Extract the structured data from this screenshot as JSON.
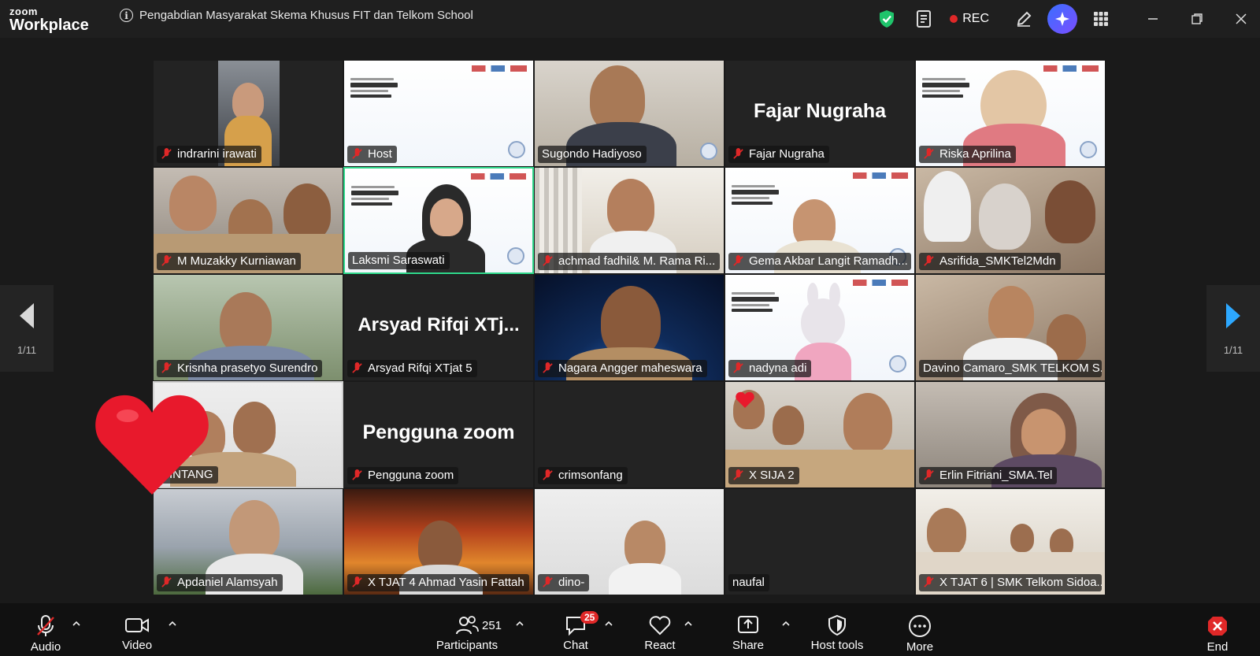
{
  "app": {
    "brand_top": "zoom",
    "brand_bottom": "Workplace"
  },
  "meeting": {
    "title": "Pengabdian Masyarakat Skema Khusus FIT dan Telkom School"
  },
  "titlebar": {
    "rec_label": "REC"
  },
  "pager": {
    "left": "1/11",
    "right": "1/11"
  },
  "tiles": [
    {
      "name": "indrarini irawati",
      "big": ""
    },
    {
      "name": "Host",
      "big": ""
    },
    {
      "name": "Sugondo Hadiyoso",
      "big": ""
    },
    {
      "name": "Fajar Nugraha",
      "big": "Fajar Nugraha"
    },
    {
      "name": "Riska Aprilina",
      "big": ""
    },
    {
      "name": "M Muzakky Kurniawan",
      "big": ""
    },
    {
      "name": "Laksmi Saraswati",
      "big": ""
    },
    {
      "name": "achmad fadhil& M. Rama Ri...",
      "big": ""
    },
    {
      "name": "Gema Akbar Langit Ramadh...",
      "big": ""
    },
    {
      "name": "Asrifida_SMKTel2Mdn",
      "big": ""
    },
    {
      "name": "Krisnha prasetyo Surendro",
      "big": ""
    },
    {
      "name": "Arsyad Rifqi XTjat 5",
      "big": "Arsyad Rifqi XTj..."
    },
    {
      "name": "Nagara Angger maheswara",
      "big": ""
    },
    {
      "name": "nadyna adi",
      "big": ""
    },
    {
      "name": "Davino Camaro_SMK TELKOM S...",
      "big": ""
    },
    {
      "name": "BINTANG",
      "big": ""
    },
    {
      "name": "Pengguna zoom",
      "big": "Pengguna zoom"
    },
    {
      "name": "crimsonfang",
      "big": ""
    },
    {
      "name": "X SIJA 2",
      "big": ""
    },
    {
      "name": "Erlin Fitriani_SMA.Tel",
      "big": ""
    },
    {
      "name": "Apdaniel Alamsyah",
      "big": ""
    },
    {
      "name": "X TJAT 4 Ahmad Yasin Fattah",
      "big": ""
    },
    {
      "name": "dino-",
      "big": ""
    },
    {
      "name": "naufal",
      "big": ""
    },
    {
      "name": "X TJAT 6 | SMK Telkom Sidoa...",
      "big": ""
    }
  ],
  "toolbar": {
    "audio": "Audio",
    "video": "Video",
    "participants": "Participants",
    "participants_count": "251",
    "chat": "Chat",
    "chat_badge": "25",
    "react": "React",
    "share": "Share",
    "host_tools": "Host tools",
    "more": "More",
    "end": "End"
  },
  "colors": {
    "active_speaker": "#2fd88b",
    "end_red": "#e02828",
    "shield_green": "#1fc46b"
  }
}
